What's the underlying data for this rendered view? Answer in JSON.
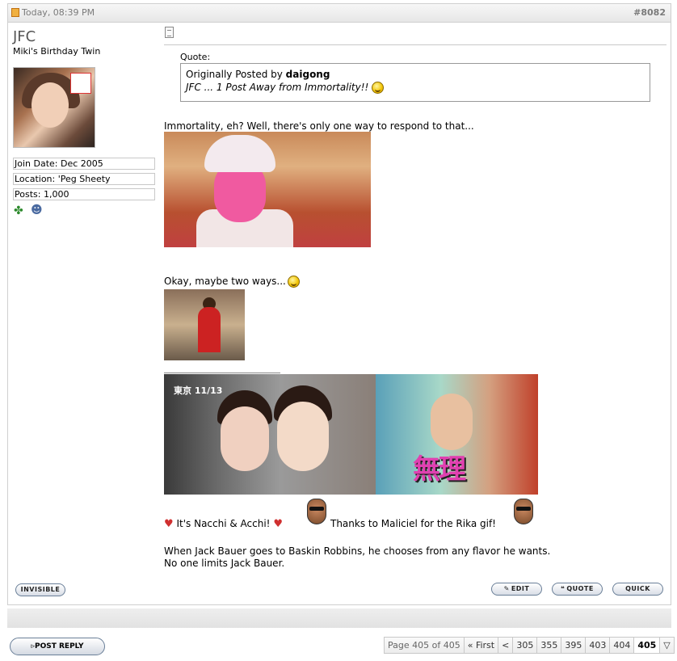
{
  "post": {
    "date": "Today, 08:39 PM",
    "number": "#8082"
  },
  "user": {
    "name": "JFC",
    "title": "Miki's Birthday Twin",
    "join_date": "Join Date: Dec 2005",
    "location": "Location: 'Peg Sheety",
    "posts": "Posts: 1,000"
  },
  "quote": {
    "label": "Quote:",
    "originally": "Originally Posted by ",
    "author": "daigong",
    "text": "JFC ... 1 Post Away from Immortality!!"
  },
  "body": {
    "line1": "Immortality, eh? Well, there's only one way to respond to that...",
    "line2": "Okay, maybe two ways...",
    "sig_a": "It's Nacchi & Acchi!",
    "sig_b": "Thanks to Maliciel for the Rika gif!",
    "sig_c1": "When Jack Bauer goes to Baskin Robbins, he chooses from any flavor he wants.",
    "sig_c2": "No one limits Jack Bauer.",
    "img3_tv": "東京 11/13",
    "img3_kanji": "無理"
  },
  "buttons": {
    "invisible": "INVISIBLE",
    "edit": "EDIT",
    "quote": "QUOTE",
    "quick": "QUICK",
    "post_reply": "POST REPLY"
  },
  "pagenav": {
    "label": "Page 405 of 405",
    "first": "« First",
    "prev": "<",
    "pages": [
      "305",
      "355",
      "395",
      "403",
      "404"
    ],
    "current": "405",
    "menu": "▽"
  },
  "icons": {
    "clover": "clover-icon",
    "person": "person-icon"
  }
}
